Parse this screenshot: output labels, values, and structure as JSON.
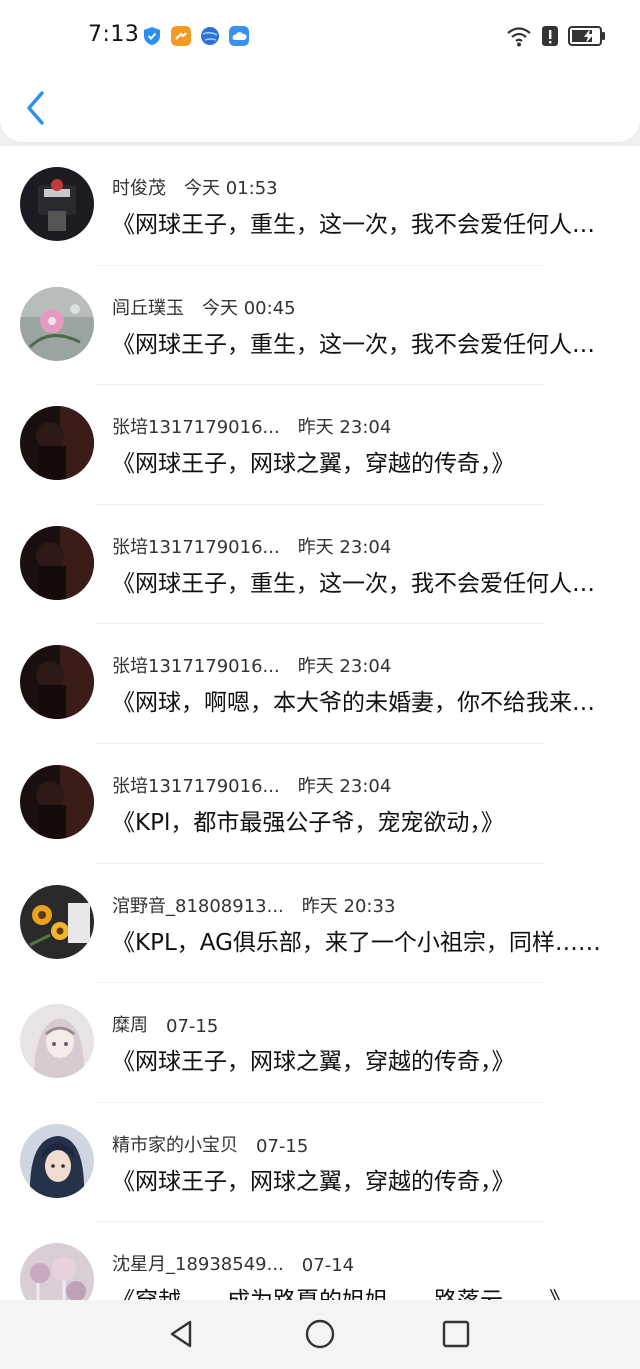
{
  "status_bar": {
    "time": "7:13",
    "left_icons": [
      "shield-icon",
      "app-orange-icon",
      "globe-icon",
      "cloud-icon"
    ],
    "right_icons": [
      "wifi-icon",
      "alert-icon",
      "battery-charging-icon"
    ]
  },
  "header": {
    "back_icon": "chevron-left-icon"
  },
  "messages": [
    {
      "user": "时俊茂",
      "time": "今天 01:53",
      "text": "《网球王子，重生，这一次，我不会爱任何人了》"
    },
    {
      "user": "闾丘璞玉",
      "time": "今天 00:45",
      "text": "《网球王子，重生，这一次，我不会爱任何人了》"
    },
    {
      "user": "张培1317179016...",
      "time": "昨天 23:04",
      "text": "《网球王子，网球之翼，穿越的传奇，》"
    },
    {
      "user": "张培1317179016...",
      "time": "昨天 23:04",
      "text": "《网球王子，重生，这一次，我不会爱任何人了》"
    },
    {
      "user": "张培1317179016...",
      "time": "昨天 23:04",
      "text": "《网球，啊嗯，本大爷的未婚妻，你不给我来点什么》"
    },
    {
      "user": "张培1317179016...",
      "time": "昨天 23:04",
      "text": "《KPl，都市最强公子爷，宠宠欲动，》"
    },
    {
      "user": "涫野音_81808913...",
      "time": "昨天 20:33",
      "text": "《KPL，AG俱乐部，来了一个小祖宗，同样……》"
    },
    {
      "user": "糜周",
      "time": "07-15",
      "text": "《网球王子，网球之翼，穿越的传奇，》"
    },
    {
      "user": "精市家的小宝贝",
      "time": "07-15",
      "text": "《网球王子，网球之翼，穿越的传奇，》"
    },
    {
      "user": "沈星月_18938549...",
      "time": "07-14",
      "text": "《穿越……成为路夏的姐姐……路落云……》"
    }
  ],
  "nav_bar": {
    "icons": [
      "back-triangle-icon",
      "home-circle-icon",
      "recents-square-icon"
    ]
  },
  "colors": {
    "accent": "#2b8ff0",
    "background": "#ffffff",
    "text": "#111111"
  }
}
